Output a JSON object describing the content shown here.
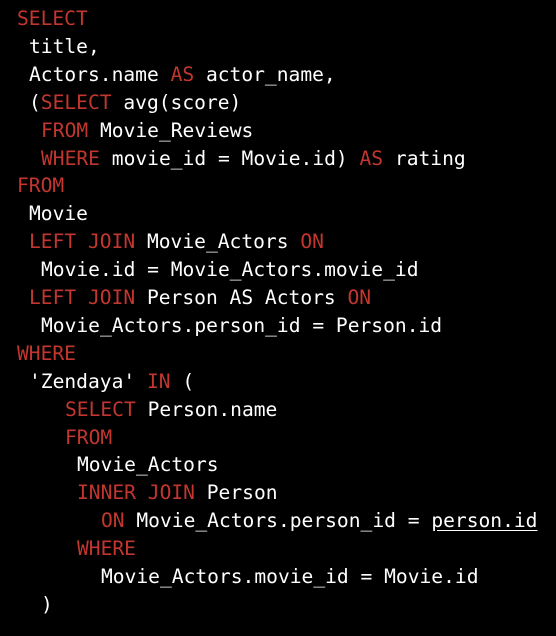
{
  "colors": {
    "background": "#000000",
    "keyword": "#c2362f",
    "text": "#ffffff"
  },
  "lines": [
    {
      "indent": 0,
      "tokens": [
        {
          "t": "SELECT",
          "k": "kw"
        }
      ]
    },
    {
      "indent": 1,
      "tokens": [
        {
          "t": "title,",
          "k": "plain"
        }
      ]
    },
    {
      "indent": 1,
      "tokens": [
        {
          "t": "Actors.name ",
          "k": "plain"
        },
        {
          "t": "AS",
          "k": "kw"
        },
        {
          "t": " actor_name,",
          "k": "plain"
        }
      ]
    },
    {
      "indent": 1,
      "tokens": [
        {
          "t": "(",
          "k": "plain"
        },
        {
          "t": "SELECT",
          "k": "kw"
        },
        {
          "t": " avg(score)",
          "k": "plain"
        }
      ]
    },
    {
      "indent": 2,
      "tokens": [
        {
          "t": "FROM",
          "k": "kw"
        },
        {
          "t": " Movie_Reviews",
          "k": "plain"
        }
      ]
    },
    {
      "indent": 2,
      "tokens": [
        {
          "t": "WHERE",
          "k": "kw"
        },
        {
          "t": " movie_id = Movie.id) ",
          "k": "plain"
        },
        {
          "t": "AS",
          "k": "kw"
        },
        {
          "t": " rating",
          "k": "plain"
        }
      ]
    },
    {
      "indent": 0,
      "tokens": [
        {
          "t": "FROM",
          "k": "kw"
        }
      ]
    },
    {
      "indent": 1,
      "tokens": [
        {
          "t": "Movie",
          "k": "plain"
        }
      ]
    },
    {
      "indent": 1,
      "tokens": [
        {
          "t": "LEFT JOIN",
          "k": "kw"
        },
        {
          "t": " Movie_Actors ",
          "k": "plain"
        },
        {
          "t": "ON",
          "k": "kw"
        }
      ]
    },
    {
      "indent": 2,
      "tokens": [
        {
          "t": "Movie.id = Movie_Actors.movie_id",
          "k": "plain"
        }
      ]
    },
    {
      "indent": 1,
      "tokens": [
        {
          "t": "LEFT JOIN",
          "k": "kw"
        },
        {
          "t": " Person AS Actors ",
          "k": "plain"
        },
        {
          "t": "ON",
          "k": "kw"
        }
      ]
    },
    {
      "indent": 2,
      "tokens": [
        {
          "t": "Movie_Actors.person_id = Person.id",
          "k": "plain"
        }
      ]
    },
    {
      "indent": 0,
      "tokens": [
        {
          "t": "WHERE",
          "k": "kw"
        }
      ]
    },
    {
      "indent": 1,
      "tokens": [
        {
          "t": "'Zendaya' ",
          "k": "plain"
        },
        {
          "t": "IN",
          "k": "kw"
        },
        {
          "t": " (",
          "k": "plain"
        }
      ]
    },
    {
      "indent": 4,
      "tokens": [
        {
          "t": "SELECT",
          "k": "kw"
        },
        {
          "t": " Person.name",
          "k": "plain"
        }
      ]
    },
    {
      "indent": 4,
      "tokens": [
        {
          "t": "FROM",
          "k": "kw"
        }
      ]
    },
    {
      "indent": 5,
      "tokens": [
        {
          "t": "Movie_Actors",
          "k": "plain"
        }
      ]
    },
    {
      "indent": 5,
      "tokens": [
        {
          "t": "INNER JOIN",
          "k": "kw"
        },
        {
          "t": " Person",
          "k": "plain"
        }
      ]
    },
    {
      "indent": 7,
      "tokens": [
        {
          "t": "ON",
          "k": "kw"
        },
        {
          "t": " Movie_Actors.person_id = ",
          "k": "plain"
        },
        {
          "t": "person.id",
          "k": "link"
        }
      ]
    },
    {
      "indent": 5,
      "tokens": [
        {
          "t": "WHERE",
          "k": "kw"
        }
      ]
    },
    {
      "indent": 7,
      "tokens": [
        {
          "t": "Movie_Actors.movie_id = Movie.id",
          "k": "plain"
        }
      ]
    },
    {
      "indent": 2,
      "tokens": [
        {
          "t": ")",
          "k": "plain"
        }
      ]
    }
  ]
}
